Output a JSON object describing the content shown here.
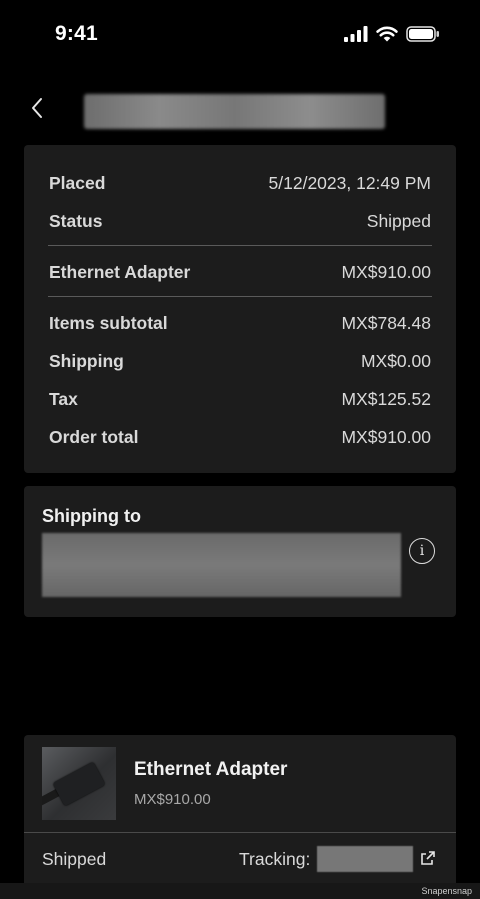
{
  "status_bar": {
    "time": "9:41"
  },
  "header": {
    "back_icon": "chevron-left-icon",
    "title_redacted": true
  },
  "summary": {
    "placed_label": "Placed",
    "placed_value": "5/12/2023, 12:49 PM",
    "status_label": "Status",
    "status_value": "Shipped",
    "item_label": "Ethernet Adapter",
    "item_value": "MX$910.00",
    "subtotal_label": "Items subtotal",
    "subtotal_value": "MX$784.48",
    "shipping_label": "Shipping",
    "shipping_value": "MX$0.00",
    "tax_label": "Tax",
    "tax_value": "MX$125.52",
    "total_label": "Order total",
    "total_value": "MX$910.00"
  },
  "shipping_card": {
    "title": "Shipping to",
    "info_icon": "info-icon"
  },
  "item_card": {
    "name": "Ethernet Adapter",
    "price": "MX$910.00",
    "status": "Shipped",
    "tracking_label": "Tracking:",
    "tracking_icon": "external-link-icon"
  },
  "watermark": "Snapensnap"
}
